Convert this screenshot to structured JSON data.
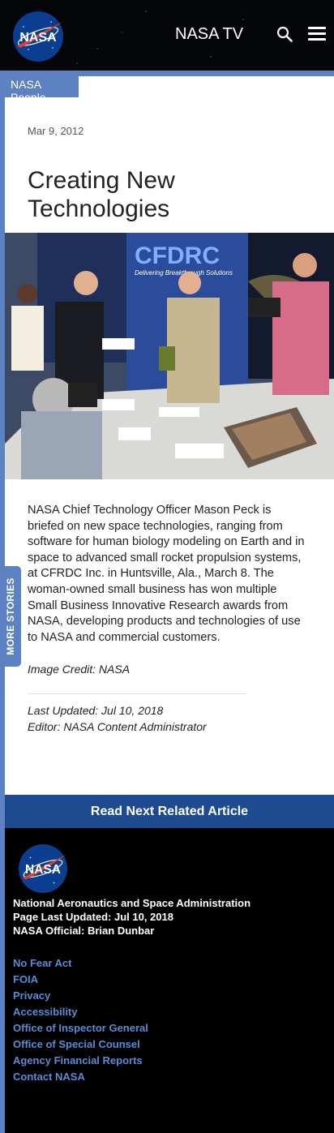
{
  "header": {
    "logo_text": "NASA",
    "nasa_tv": "NASA TV",
    "search_icon": "search-icon",
    "menu_icon": "hamburger-menu-icon"
  },
  "section": {
    "label": "NASA People"
  },
  "article": {
    "date": "Mar 9, 2012",
    "title": "Creating New Technologies",
    "photo_labels": {
      "banner_logo": "CFDRC",
      "banner_tagline": "Delivering Breakthrough Solutions"
    },
    "body": "NASA Chief Technology Officer Mason Peck is briefed on new space technologies, ranging from software for human biology modeling on Earth and in space to advanced small rocket propulsion systems, at CFRDC Inc. in Huntsville, Ala., March 8. The woman-owned small business has won multiple Small Business Innovative Research awards from NASA, developing products and technologies of use to NASA and commercial customers.",
    "credit": "Image Credit: NASA",
    "last_updated": "Last Updated: Jul 10, 2018",
    "editor": "Editor: NASA Content Administrator"
  },
  "more_stories": "MORE STORIES",
  "read_next": "Read Next Related Article",
  "footer": {
    "logo_text": "NASA",
    "org": "National Aeronautics and Space Administration",
    "page_updated": "Page Last Updated: Jul 10, 2018",
    "official": "NASA Official: Brian Dunbar",
    "links": [
      "No Fear Act",
      "FOIA",
      "Privacy",
      "Accessibility",
      "Office of Inspector General",
      "Office of Special Counsel",
      "Agency Financial Reports",
      "Contact NASA"
    ]
  },
  "colors": {
    "accent_blue": "#5c82c2",
    "read_next_bg": "#1e4b8f",
    "footer_link": "#5c8ad6",
    "nasa_red": "#e03c31",
    "nasa_blue": "#0b3d91"
  }
}
